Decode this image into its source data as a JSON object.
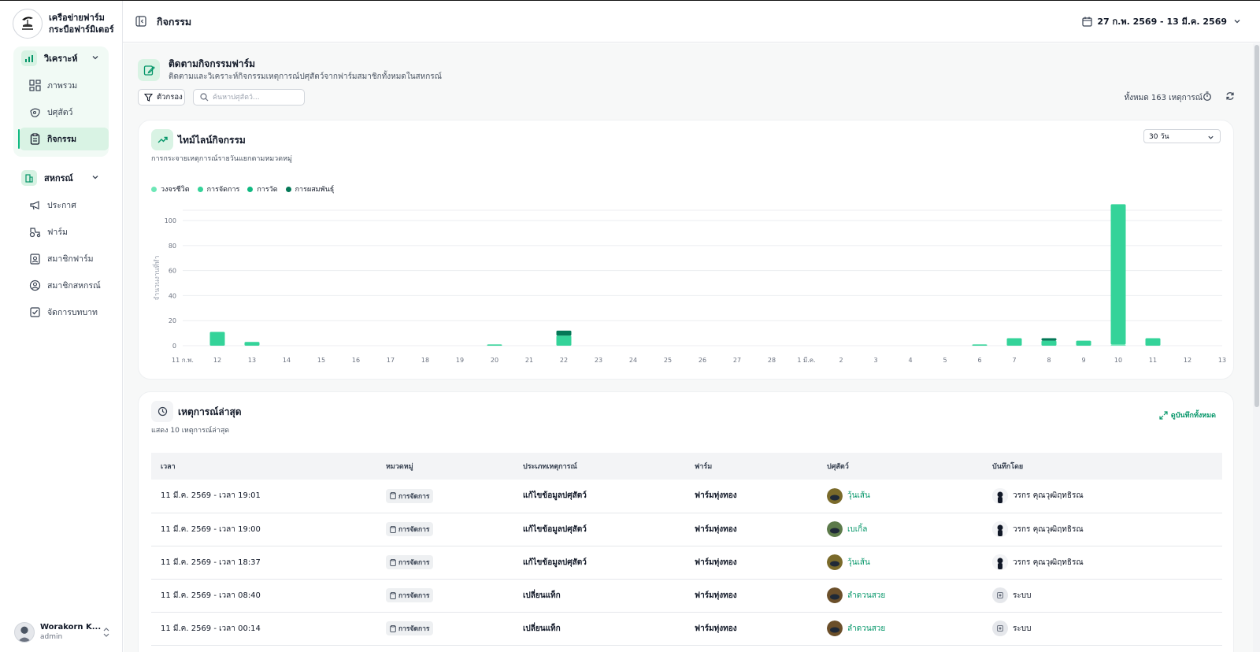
{
  "brand": {
    "line1": "เครือข่ายฟาร์ม",
    "line2": "กระบือฟาร์มิเตอร์",
    "logo_icon": "buffalo-logo-icon"
  },
  "sidebar": {
    "analyze_group": {
      "label": "วิเคราะห์",
      "items": [
        {
          "label": "ภาพรวม",
          "icon": "dashboard-icon"
        },
        {
          "label": "ปศุสัตว์",
          "icon": "livestock-icon"
        },
        {
          "label": "กิจกรรม",
          "icon": "clipboard-icon",
          "active": true
        }
      ]
    },
    "coop_group": {
      "label": "สหกรณ์",
      "items": [
        {
          "label": "ประกาศ",
          "icon": "megaphone-icon"
        },
        {
          "label": "ฟาร์ม",
          "icon": "tractor-icon"
        },
        {
          "label": "สมาชิกฟาร์ม",
          "icon": "member-card-icon"
        },
        {
          "label": "สมาชิกสหกรณ์",
          "icon": "user-circle-icon"
        },
        {
          "label": "จัดการบทบาท",
          "icon": "checkbox-icon"
        }
      ]
    },
    "user": {
      "name": "Worakorn K...",
      "role": "admin"
    }
  },
  "header": {
    "title": "กิจกรรม",
    "date_range": "27 ก.พ. 2569 - 13 มี.ค. 2569"
  },
  "page": {
    "title": "ติดตามกิจกรรมฟาร์ม",
    "subtitle": "ติดตามและวิเคราะห์กิจกรรมเหตุการณ์ปศุสัตว์จากฟาร์มสมาชิกทั้งหมดในสหกรณ์",
    "filter_label": "ตัวกรอง",
    "search_placeholder": "ค้นหาปศุสัตว์...",
    "total_label": "ทั้งหมด 163 เหตุการณ์"
  },
  "timeline": {
    "title": "ไทม์ไลน์กิจกรรม",
    "subtitle": "การกระจายเหตุการณ์รายวันแยกตามหมวดหมู่",
    "range": "30 วัน"
  },
  "chart_data": {
    "type": "bar",
    "stacked": true,
    "ylabel": "จำนวนงานที่ทำ",
    "ylim": [
      0,
      112
    ],
    "yticks": [
      0,
      20,
      40,
      60,
      80,
      100
    ],
    "grid": true,
    "legend_position": "top-left",
    "categories": [
      "11 ก.พ.",
      "12",
      "13",
      "14",
      "15",
      "16",
      "17",
      "18",
      "19",
      "20",
      "21",
      "22",
      "23",
      "24",
      "25",
      "26",
      "27",
      "28",
      "1 มี.ค.",
      "2",
      "3",
      "4",
      "5",
      "6",
      "7",
      "8",
      "9",
      "10",
      "11",
      "12",
      "13"
    ],
    "series": [
      {
        "name": "วงจรชีวิต",
        "color": "#6ee7b7",
        "values": [
          0,
          0,
          0,
          0,
          0,
          0,
          0,
          0,
          0,
          0,
          0,
          0,
          0,
          0,
          0,
          0,
          0,
          0,
          0,
          0,
          0,
          0,
          0,
          0,
          0,
          0,
          0,
          1,
          0,
          0,
          0
        ]
      },
      {
        "name": "การจัดการ",
        "color": "#34d399",
        "values": [
          0,
          11,
          3,
          0,
          0,
          0,
          0,
          0,
          0,
          1,
          0,
          8,
          0,
          0,
          0,
          0,
          0,
          0,
          0,
          0,
          0,
          0,
          0,
          1,
          6,
          4,
          4,
          112,
          6,
          0,
          0
        ]
      },
      {
        "name": "การวัด",
        "color": "#10b981",
        "values": [
          0,
          0,
          0,
          0,
          0,
          0,
          0,
          0,
          0,
          0,
          0,
          0,
          0,
          0,
          0,
          0,
          0,
          0,
          0,
          0,
          0,
          0,
          0,
          0,
          0,
          0,
          0,
          0,
          0,
          0,
          0
        ]
      },
      {
        "name": "การผสมพันธุ์",
        "color": "#047857",
        "values": [
          0,
          0,
          0,
          0,
          0,
          0,
          0,
          0,
          0,
          0,
          0,
          4,
          0,
          0,
          0,
          0,
          0,
          0,
          0,
          0,
          0,
          0,
          0,
          0,
          0,
          2,
          0,
          0,
          0,
          0,
          0
        ]
      }
    ]
  },
  "events": {
    "title": "เหตุการณ์ล่าสุด",
    "subtitle": "แสดง 10 เหตุการณ์ล่าสุด",
    "view_all": "ดูบันทึกทั้งหมด",
    "columns": [
      "เวลา",
      "หมวดหมู่",
      "ประเภทเหตุการณ์",
      "ฟาร์ม",
      "ปศุสัตว์",
      "บันทึกโดย"
    ],
    "rows": [
      {
        "time": "11 มี.ค. 2569 - เวลา 19:01",
        "category": "การจัดการ",
        "type": "แก้ไขข้อมูลปศุสัตว์",
        "farm": "ฟาร์มทุ่งทอง",
        "animal": "วุ้นเส้น",
        "recorder": "วรกร คุณวุฒิฤทธิรณ"
      },
      {
        "time": "11 มี.ค. 2569 - เวลา 19:00",
        "category": "การจัดการ",
        "type": "แก้ไขข้อมูลปศุสัตว์",
        "farm": "ฟาร์มทุ่งทอง",
        "animal": "เบเกิ้ล",
        "recorder": "วรกร คุณวุฒิฤทธิรณ"
      },
      {
        "time": "11 มี.ค. 2569 - เวลา 18:37",
        "category": "การจัดการ",
        "type": "แก้ไขข้อมูลปศุสัตว์",
        "farm": "ฟาร์มทุ่งทอง",
        "animal": "วุ้นเส้น",
        "recorder": "วรกร คุณวุฒิฤทธิรณ"
      },
      {
        "time": "11 มี.ค. 2569 - เวลา 08:40",
        "category": "การจัดการ",
        "type": "เปลี่ยนแท็ก",
        "farm": "ฟาร์มทุ่งทอง",
        "animal": "ลำดวนสวย",
        "recorder": "ระบบ"
      },
      {
        "time": "11 มี.ค. 2569 - เวลา 00:14",
        "category": "การจัดการ",
        "type": "เปลี่ยนแท็ก",
        "farm": "ฟาร์มทุ่งทอง",
        "animal": "ลำดวนสวย",
        "recorder": "ระบบ"
      }
    ]
  },
  "colors": {
    "accent": "#10b981",
    "accent_light": "#d9f3e4",
    "link": "#059669"
  }
}
